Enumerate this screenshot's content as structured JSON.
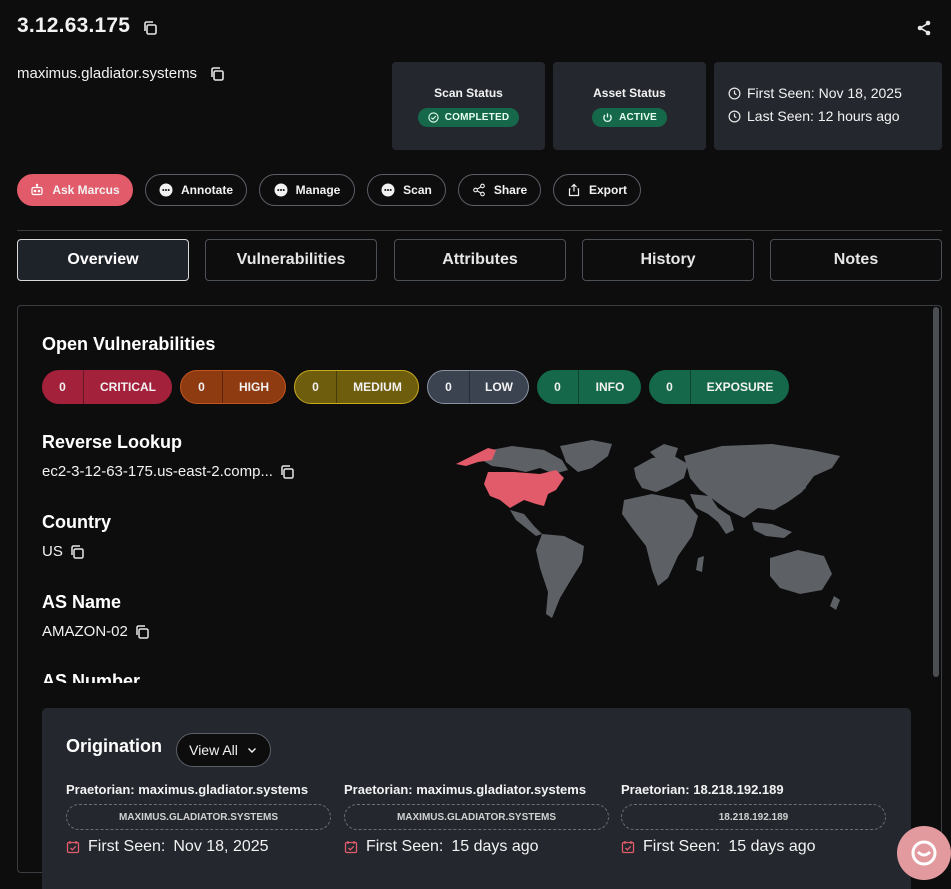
{
  "header": {
    "ip": "3.12.63.175",
    "hostname": "maximus.gladiator.systems"
  },
  "status": {
    "scan_label": "Scan Status",
    "scan_value": "COMPLETED",
    "asset_label": "Asset Status",
    "asset_value": "ACTIVE",
    "first_seen": "First Seen: Nov 18, 2025",
    "last_seen": "Last Seen: 12 hours ago"
  },
  "actions": [
    "Ask Marcus",
    "Annotate",
    "Manage",
    "Scan",
    "Share",
    "Export"
  ],
  "tabs": [
    "Overview",
    "Vulnerabilities",
    "Attributes",
    "History",
    "Notes"
  ],
  "vulnerabilities": {
    "title": "Open Vulnerabilities",
    "items": [
      {
        "count": "0",
        "label": "CRITICAL",
        "color": "#a3213a"
      },
      {
        "count": "0",
        "label": "HIGH",
        "color": "#8f3b12"
      },
      {
        "count": "0",
        "label": "MEDIUM",
        "color": "#6f5d0e"
      },
      {
        "count": "0",
        "label": "LOW",
        "color": "#3b4250"
      },
      {
        "count": "0",
        "label": "INFO",
        "color": "#15694a"
      },
      {
        "count": "0",
        "label": "EXPOSURE",
        "color": "#15694a"
      }
    ]
  },
  "info": {
    "reverse_lookup_label": "Reverse Lookup",
    "reverse_lookup_value": "ec2-3-12-63-175.us-east-2.comp...",
    "country_label": "Country",
    "country_value": "US",
    "as_name_label": "AS Name",
    "as_name_value": "AMAZON-02",
    "as_number_label": "AS Number"
  },
  "map": {
    "highlight_country": "US",
    "highlight_color": "#e25b6a",
    "land_color": "#5d6166"
  },
  "origination": {
    "title": "Origination",
    "view_all": "View All",
    "items": [
      {
        "title": "Praetorian: maximus.gladiator.systems",
        "tag": "MAXIMUS.GLADIATOR.SYSTEMS",
        "first_seen_label": "First Seen:",
        "first_seen": "Nov 18, 2025"
      },
      {
        "title": "Praetorian: maximus.gladiator.systems",
        "tag": "MAXIMUS.GLADIATOR.SYSTEMS",
        "first_seen_label": "First Seen:",
        "first_seen": "15 days ago"
      },
      {
        "title": "Praetorian: 18.218.192.189",
        "tag": "18.218.192.189",
        "first_seen_label": "First Seen:",
        "first_seen": "15 days ago"
      }
    ]
  },
  "icons": [
    "copy-icon",
    "share-icon",
    "clock-icon",
    "check-circle-icon",
    "power-icon",
    "robot-icon",
    "dots-icon",
    "export-icon",
    "calendar-check-icon",
    "chevron-down-icon",
    "chat-icon"
  ]
}
